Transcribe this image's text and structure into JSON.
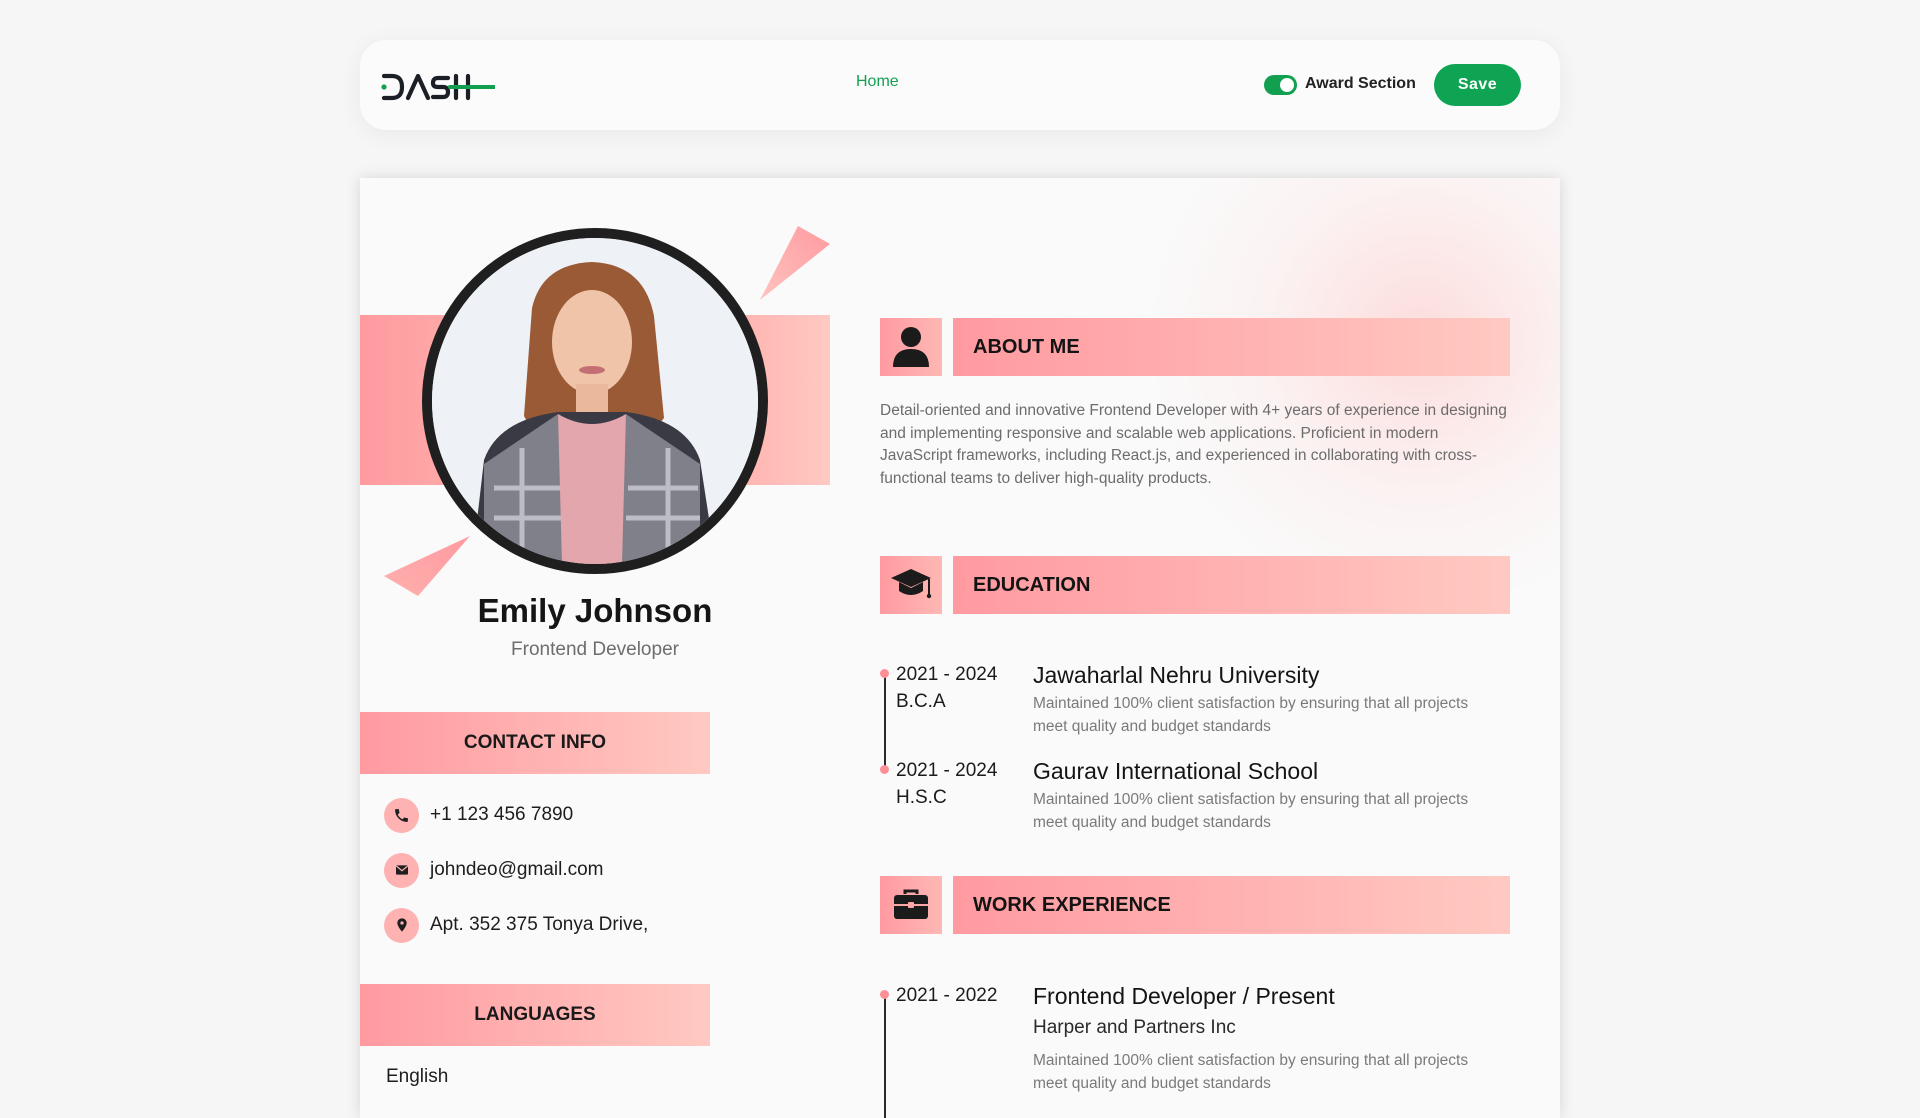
{
  "navbar": {
    "logo": "DASH",
    "home_link": "Home",
    "toggle_label": "Award Section",
    "toggle_on": true,
    "save_label": "Save"
  },
  "colors": {
    "accent_green": "#0fa454",
    "accent_pink": "#ff9aa0",
    "accent_pink_light": "#ffc9c2"
  },
  "profile": {
    "name": "Emily Johnson",
    "role": "Frontend Developer"
  },
  "contact": {
    "heading": "CONTACT INFO",
    "items": [
      {
        "icon": "phone-icon",
        "text": "+1 123 456 7890"
      },
      {
        "icon": "mail-icon",
        "text": "johndeo@gmail.com"
      },
      {
        "icon": "location-pin-icon",
        "text": "Apt. 352 375 Tonya Drive,"
      }
    ]
  },
  "languages": {
    "heading": "LANGUAGES",
    "items": [
      "English"
    ]
  },
  "about": {
    "heading": "ABOUT ME",
    "icon": "user-icon",
    "text": "Detail-oriented and innovative Frontend Developer with 4+ years of experience in designing and implementing responsive and scalable web applications. Proficient in modern JavaScript frameworks, including React.js, and experienced in collaborating with cross-functional teams to deliver high-quality products."
  },
  "education": {
    "heading": "EDUCATION",
    "icon": "graduation-cap-icon",
    "items": [
      {
        "years": "2021 - 2024",
        "degree": "B.C.A",
        "school": "Jawaharlal Nehru University",
        "description": "Maintained 100% client satisfaction by ensuring that all projects meet quality and budget standards"
      },
      {
        "years": "2021 - 2024",
        "degree": "H.S.C",
        "school": "Gaurav International School",
        "description": "Maintained 100% client satisfaction by ensuring that all projects meet quality and budget standards"
      }
    ]
  },
  "work": {
    "heading": "WORK EXPERIENCE",
    "icon": "briefcase-icon",
    "items": [
      {
        "years": "2021 - 2022",
        "title": "Frontend Developer / Present",
        "company": "Harper and Partners Inc",
        "description": "Maintained 100% client satisfaction by ensuring that all projects meet quality and budget standards"
      }
    ]
  }
}
